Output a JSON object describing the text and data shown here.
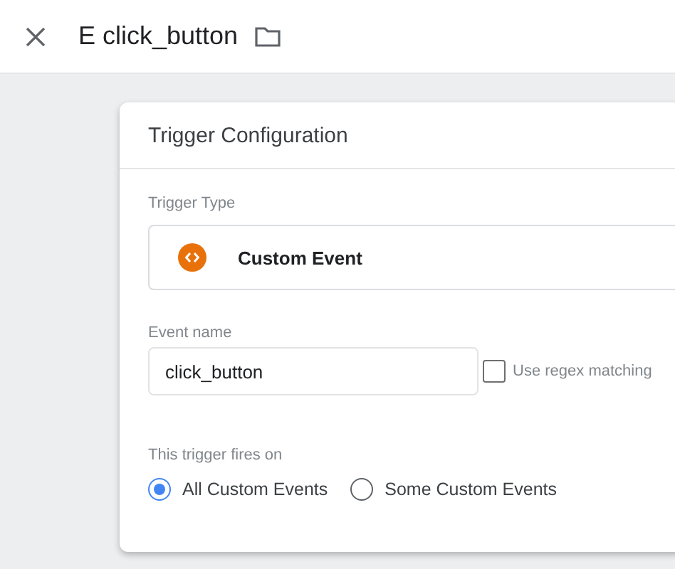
{
  "header": {
    "title": "E click_button"
  },
  "panel": {
    "title": "Trigger Configuration",
    "trigger_type": {
      "label": "Trigger Type",
      "value": "Custom Event"
    },
    "event_name": {
      "label": "Event name",
      "value": "click_button"
    },
    "regex": {
      "label": "Use regex matching",
      "checked": false
    },
    "fires_on": {
      "label": "This trigger fires on",
      "options": [
        {
          "label": "All Custom Events",
          "selected": true
        },
        {
          "label": "Some Custom Events",
          "selected": false
        }
      ]
    }
  }
}
